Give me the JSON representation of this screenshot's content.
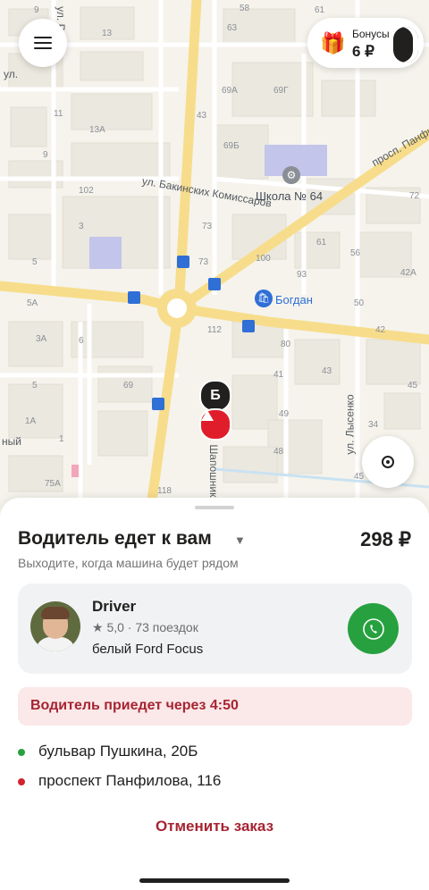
{
  "map": {
    "streets": {
      "bakinskih": "ул. Бакинских Комиссаров",
      "panfilova": "просп. Панфилова",
      "lysenko": "ул. Лысенко",
      "shaposhnikova": "ул. Шапошникова",
      "top_left": "ул.",
      "left_edge": "ный",
      "top_vertical": "ул. Рас"
    },
    "poi": {
      "school": "Школа № 64",
      "bogdan": "Богдан"
    },
    "house_numbers": [
      "58",
      "61",
      "63",
      "9",
      "13",
      "11",
      "13А",
      "9",
      "102",
      "3",
      "5",
      "5А",
      "3А",
      "6",
      "5",
      "1А",
      "1",
      "75А",
      "69А",
      "69Г",
      "69Б",
      "73",
      "100",
      "112",
      "69",
      "118",
      "73",
      "80",
      "61",
      "56",
      "93",
      "50",
      "42А",
      "42",
      "72",
      "41",
      "43",
      "45",
      "34",
      "49",
      "48",
      "45",
      "43"
    ]
  },
  "bonus": {
    "label": "Бонусы",
    "value": "6 ₽"
  },
  "markers": {
    "destination": "Б"
  },
  "sheet": {
    "title": "Водитель едет к вам",
    "caret": "▼",
    "price": "298 ₽",
    "subtitle": "Выходите, когда машина будет рядом"
  },
  "driver": {
    "name": "Driver",
    "rating": "★ 5,0 · 73 поездок",
    "car": "белый Ford Focus"
  },
  "eta": {
    "text": "Водитель приедет через 4:50"
  },
  "route": {
    "from": "бульвар Пушкина, 20Б",
    "to": "проспект Панфилова, 116"
  },
  "actions": {
    "cancel": "Отменить заказ"
  },
  "colors": {
    "accent_green": "#27a140",
    "accent_red": "#e01e2b",
    "cancel_red": "#a62433",
    "banner_bg": "#fbe8e8",
    "road_yellow": "#f7dd8b"
  },
  "icons": {
    "menu": "hamburger-icon",
    "gift": "gift-icon",
    "moon": "moon-icon",
    "phone": "phone-icon",
    "locate": "locate-icon"
  }
}
